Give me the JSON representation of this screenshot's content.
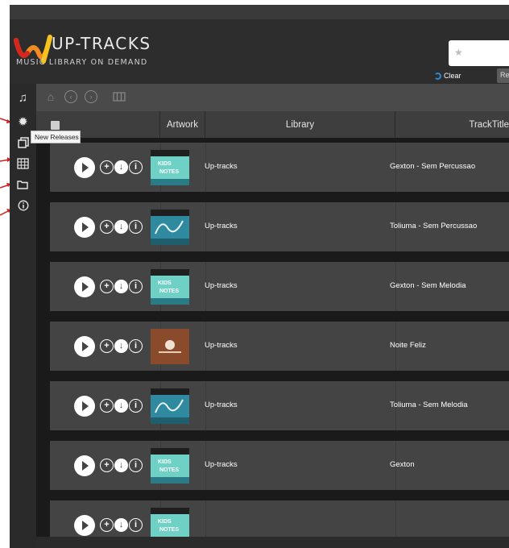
{
  "brand": {
    "name": "UP-TRACKS",
    "tagline": "MUSIC LIBRARY ON DEMAND",
    "colors": {
      "logo_red": "#d9261c",
      "logo_orange": "#f28c1f",
      "logo_yellow": "#f6c21c"
    }
  },
  "search": {
    "value": "",
    "placeholder": ""
  },
  "header": {
    "clear_label": "Clear",
    "re_button_label": "Re"
  },
  "sidebar": {
    "items": [
      {
        "icon": "music-note-icon"
      },
      {
        "icon": "new-releases-icon"
      },
      {
        "icon": "copy-icon"
      },
      {
        "icon": "grid-icon"
      },
      {
        "icon": "folder-icon"
      },
      {
        "icon": "info-icon"
      }
    ],
    "tooltip": "New Releases"
  },
  "toolbar": {
    "icons": [
      "home-icon",
      "back-icon",
      "forward-icon",
      "columns-icon"
    ]
  },
  "table": {
    "columns": [
      "Artwork",
      "Library",
      "TrackTitle"
    ],
    "rows": [
      {
        "artwork": "kids-notes",
        "library": "Up-tracks",
        "title": "Gexton - Sem Percussao"
      },
      {
        "artwork": "blue-notes",
        "library": "Up-tracks",
        "title": "Toliuma - Sem Percussao"
      },
      {
        "artwork": "kids-notes",
        "library": "Up-tracks",
        "title": "Gexton - Sem Melodia"
      },
      {
        "artwork": "brown-album",
        "library": "Up-tracks",
        "title": "Noite Feliz"
      },
      {
        "artwork": "blue-notes",
        "library": "Up-tracks",
        "title": "Toliuma - Sem Melodia"
      },
      {
        "artwork": "kids-notes",
        "library": "Up-tracks",
        "title": "Gexton"
      },
      {
        "artwork": "kids-notes",
        "library": "",
        "title": ""
      }
    ]
  },
  "artwork_text": {
    "kids_line1": "KIDS",
    "kids_line2": "NOTES"
  }
}
